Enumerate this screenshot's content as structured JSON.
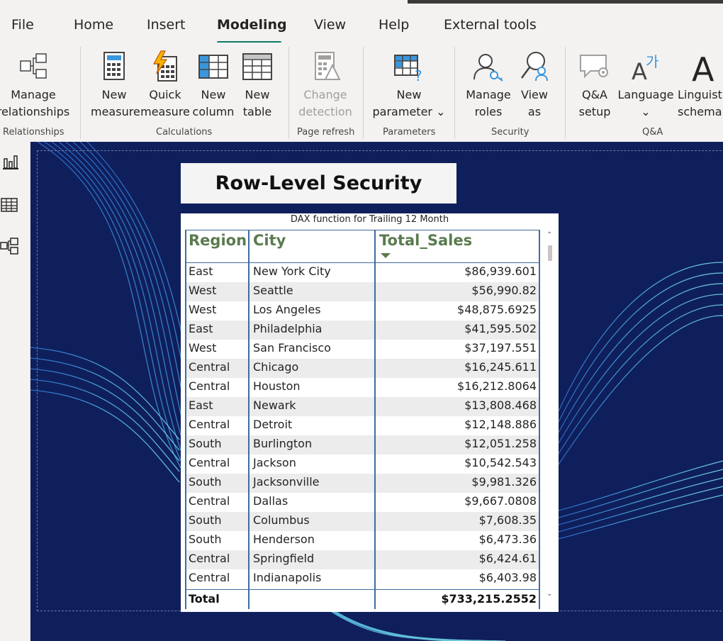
{
  "menu": {
    "items": [
      "File",
      "Home",
      "Insert",
      "Modeling",
      "View",
      "Help",
      "External tools"
    ],
    "active": "Modeling",
    "accent_color": "#117865"
  },
  "ribbon": {
    "manage_relationships": "Manage\nrelationships",
    "new_measure": "New\nmeasure",
    "quick_measure": "Quick\nmeasure",
    "new_column": "New\ncolumn",
    "new_table": "New\ntable",
    "change_detection": "Change\ndetection",
    "new_parameter": "New\nparameter ⌄",
    "manage_roles": "Manage\nroles",
    "view_as": "View\nas",
    "qa_setup": "Q&A\nsetup",
    "language": "Language\n⌄",
    "linguistic_schema": "Linguistic\nschema ⌄",
    "groups": {
      "relationships": "Relationships",
      "calculations": "Calculations",
      "page_refresh": "Page refresh",
      "parameters": "Parameters",
      "security": "Security",
      "qa": "Q&A"
    }
  },
  "report": {
    "title": "Row-Level Security",
    "table_caption": "DAX function for Trailing 12 Month",
    "columns": [
      "Region",
      "City",
      "Total_Sales"
    ],
    "rows": [
      [
        "East",
        "New York City",
        "$86,939.601"
      ],
      [
        "West",
        "Seattle",
        "$56,990.82"
      ],
      [
        "West",
        "Los Angeles",
        "$48,875.6925"
      ],
      [
        "East",
        "Philadelphia",
        "$41,595.502"
      ],
      [
        "West",
        "San Francisco",
        "$37,197.551"
      ],
      [
        "Central",
        "Chicago",
        "$16,245.611"
      ],
      [
        "Central",
        "Houston",
        "$16,212.8064"
      ],
      [
        "East",
        "Newark",
        "$13,808.468"
      ],
      [
        "Central",
        "Detroit",
        "$12,148.886"
      ],
      [
        "South",
        "Burlington",
        "$12,051.258"
      ],
      [
        "Central",
        "Jackson",
        "$10,542.543"
      ],
      [
        "South",
        "Jacksonville",
        "$9,981.326"
      ],
      [
        "Central",
        "Dallas",
        "$9,667.0808"
      ],
      [
        "South",
        "Columbus",
        "$7,608.35"
      ],
      [
        "South",
        "Henderson",
        "$6,473.36"
      ],
      [
        "Central",
        "Springfield",
        "$6,424.61"
      ],
      [
        "Central",
        "Indianapolis",
        "$6,403.98"
      ]
    ],
    "total_label": "Total",
    "total_value": "$733,215.2552",
    "header_color": "#5a7b4e",
    "grid_color": "#3f6c9f",
    "canvas_color": "#0f1f5c"
  }
}
